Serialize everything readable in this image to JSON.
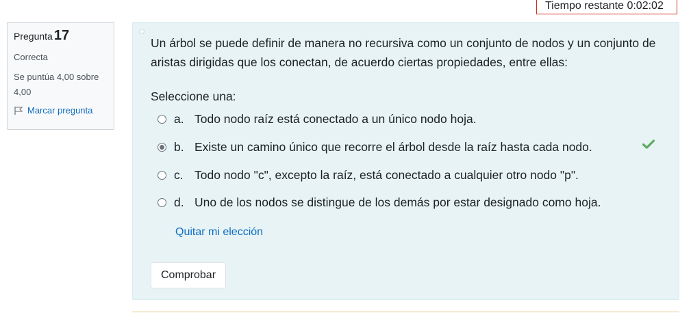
{
  "timer": {
    "label": "Tiempo restante 0:02:02"
  },
  "info": {
    "question_label": "Pregunta",
    "question_number": "17",
    "state": "Correcta",
    "grade": "Se puntúa 4,00 sobre 4,00",
    "flag_label": "Marcar pregunta"
  },
  "question": {
    "text": "Un árbol  se puede definir de manera no recursiva como un conjunto de nodos y un conjunto de aristas dirigidas que los conectan, de acuerdo ciertas propiedades, entre ellas:",
    "prompt": "Seleccione una:",
    "answers": [
      {
        "letter": "a.",
        "text": "Todo nodo raíz está conectado a un único nodo hoja.",
        "selected": false
      },
      {
        "letter": "b.",
        "text": "Existe un camino único que recorre el árbol desde la raíz hasta cada nodo.",
        "selected": true
      },
      {
        "letter": "c.",
        "text": "Todo nodo \"c\", excepto la raíz, está conectado a cualquier otro nodo \"p\".",
        "selected": false
      },
      {
        "letter": "d.",
        "text": "Uno de los nodos se distingue de los demás por estar designado como hoja.",
        "selected": false
      }
    ],
    "correct_icon": "check-icon",
    "clear_label": "Quitar mi elección",
    "check_button_label": "Comprobar"
  },
  "colors": {
    "link": "#0f6cbf",
    "correct": "#5bac5e",
    "timer_border": "#ca3120",
    "content_bg": "#e7f3f5"
  }
}
